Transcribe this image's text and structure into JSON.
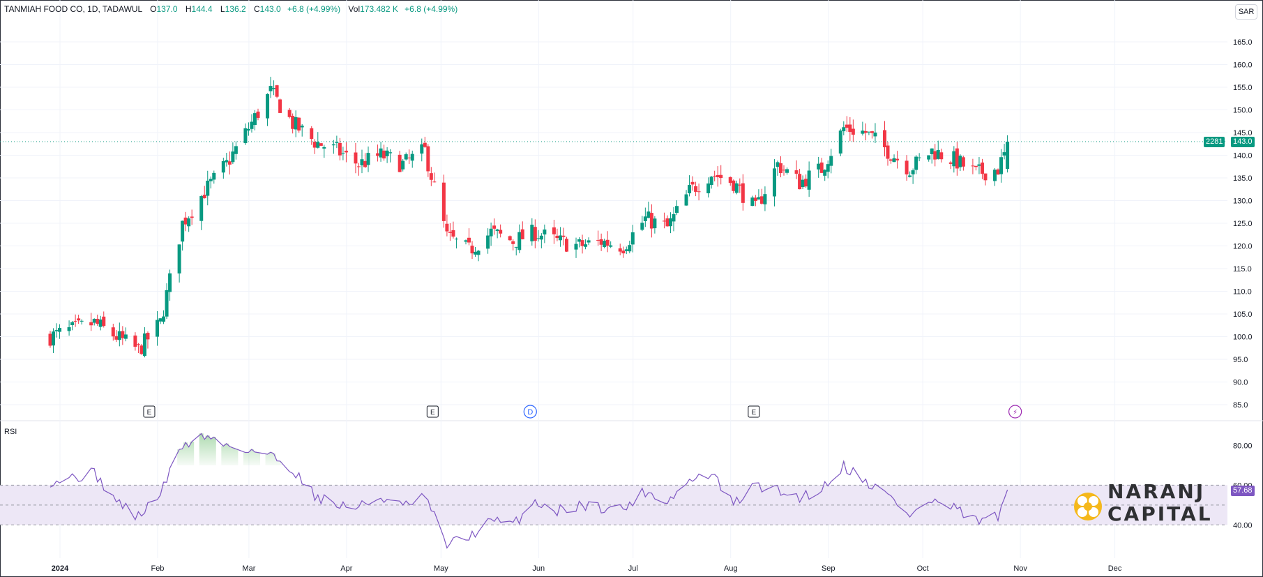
{
  "header": {
    "symbol": "TANMIAH FOOD CO, 1D, TADAWUL",
    "o_label": "O",
    "o_value": "137.0",
    "h_label": "H",
    "h_value": "144.4",
    "l_label": "L",
    "l_value": "136.2",
    "c_label": "C",
    "c_value": "143.0",
    "change": "+6.8 (+4.99%)",
    "vol_label": "Vol",
    "vol_value": "173.482 K",
    "vol_change": "+6.8 (+4.99%)"
  },
  "currency_button": "SAR",
  "rsi_label": "RSI",
  "price_tag": {
    "count": "2281",
    "value": "143.0"
  },
  "rsi_tag": "57.68",
  "events": [
    {
      "label": "E",
      "date": "2024-02-01"
    },
    {
      "label": "E",
      "date": "2024-05-01"
    },
    {
      "label": "D",
      "date": "2024-06-01"
    },
    {
      "label": "E",
      "date": "2024-08-11"
    },
    {
      "label": "⚡",
      "date": "2024-11-02"
    }
  ],
  "logo": {
    "line1": "NARANJ",
    "line2": "CAPITAL"
  },
  "colors": {
    "up": "#089981",
    "down": "#f23645",
    "rsi_line": "#7e57c2",
    "rsi_band": "#ede7f6",
    "grid": "#f0f3fa"
  },
  "chart_data": [
    {
      "type": "candlestick",
      "title": "TANMIAH FOOD CO, 1D, TADAWUL",
      "y_ticks": [
        "85.0",
        "90.0",
        "95.0",
        "100.0",
        "105.0",
        "110.0",
        "115.0",
        "120.0",
        "125.0",
        "130.0",
        "135.0",
        "140.0",
        "145.0",
        "150.0",
        "155.0",
        "160.0",
        "165.0"
      ],
      "x_ticks": [
        "2024",
        "Feb",
        "Mar",
        "Apr",
        "May",
        "Jun",
        "Jul",
        "Aug",
        "Sep",
        "Oct",
        "Nov",
        "Dec"
      ],
      "ylim": [
        85,
        165
      ],
      "x_start": "2024-01-01",
      "x_end": "2024-12-31",
      "closes_sampled": {
        "2024-01-01": 100,
        "2024-01-15": 103,
        "2024-01-22": 100,
        "2024-01-29": 97,
        "2024-02-05": 103,
        "2024-02-12": 125,
        "2024-02-19": 132,
        "2024-02-26": 138,
        "2024-03-04": 146,
        "2024-03-11": 154,
        "2024-03-18": 147,
        "2024-03-25": 143,
        "2024-04-01": 141,
        "2024-04-08": 138,
        "2024-04-15": 140,
        "2024-04-22": 138,
        "2024-04-29": 141,
        "2024-05-06": 122,
        "2024-05-13": 119,
        "2024-05-20": 123,
        "2024-05-27": 121,
        "2024-06-03": 123,
        "2024-06-10": 121,
        "2024-06-17": 120,
        "2024-06-24": 121,
        "2024-07-01": 120,
        "2024-07-08": 126,
        "2024-07-15": 124,
        "2024-07-22": 132,
        "2024-07-29": 136,
        "2024-08-05": 134,
        "2024-08-12": 128,
        "2024-08-19": 138,
        "2024-08-26": 134,
        "2024-09-02": 137,
        "2024-09-09": 146,
        "2024-09-16": 145,
        "2024-09-23": 141,
        "2024-09-30": 137,
        "2024-10-07": 141,
        "2024-10-14": 139,
        "2024-10-21": 136,
        "2024-10-28": 137,
        "2024-11-01": 143
      }
    },
    {
      "type": "line",
      "title": "RSI",
      "y_ticks": [
        "40.00",
        "60.00",
        "80.00"
      ],
      "ylim": [
        25,
        90
      ],
      "band": [
        40,
        60
      ],
      "overbought_fill": "above 70",
      "rsi_sampled": {
        "2024-01-01": 62,
        "2024-01-15": 66,
        "2024-01-22": 52,
        "2024-01-29": 44,
        "2024-02-05": 56,
        "2024-02-12": 80,
        "2024-02-19": 85,
        "2024-02-26": 80,
        "2024-03-04": 78,
        "2024-03-11": 75,
        "2024-03-18": 68,
        "2024-03-25": 55,
        "2024-04-01": 50,
        "2024-04-08": 49,
        "2024-04-15": 54,
        "2024-04-22": 49,
        "2024-04-29": 54,
        "2024-05-06": 30,
        "2024-05-13": 34,
        "2024-05-20": 42,
        "2024-05-27": 40,
        "2024-06-03": 52,
        "2024-06-10": 47,
        "2024-06-17": 50,
        "2024-06-24": 49,
        "2024-07-01": 48,
        "2024-07-08": 57,
        "2024-07-15": 52,
        "2024-07-22": 62,
        "2024-07-29": 66,
        "2024-08-05": 50,
        "2024-08-12": 60,
        "2024-08-19": 57,
        "2024-08-26": 54,
        "2024-09-02": 58,
        "2024-09-09": 70,
        "2024-09-16": 62,
        "2024-09-23": 55,
        "2024-09-30": 45,
        "2024-10-07": 52,
        "2024-10-14": 48,
        "2024-10-21": 42,
        "2024-10-28": 44,
        "2024-11-01": 57.68
      }
    }
  ]
}
